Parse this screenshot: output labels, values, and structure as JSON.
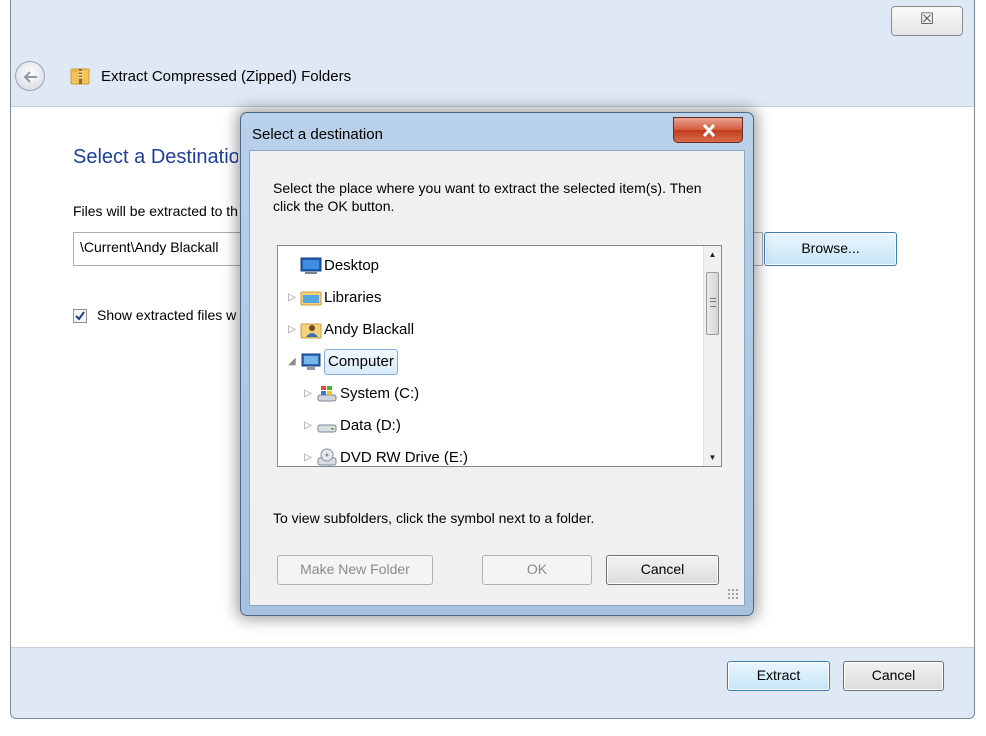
{
  "wizard": {
    "title": "Extract Compressed (Zipped) Folders",
    "close_symbol": "☒",
    "heading": "Select a Destination and Extract Files",
    "files_label": "Files will be extracted to this folder:",
    "path_value": "\\Current\\Andy Blackall",
    "browse_label": "Browse...",
    "show_checked": true,
    "show_label": "Show extracted files when complete",
    "extract_label": "Extract",
    "cancel_label": "Cancel"
  },
  "dialog": {
    "title": "Select a destination",
    "close_symbol": "X",
    "instruction": "Select the place where you want to extract the selected item(s).  Then click the OK button.",
    "tree": [
      {
        "label": "Desktop",
        "icon": "desktop-icon",
        "expander": "",
        "level": 0,
        "selected": false
      },
      {
        "label": "Libraries",
        "icon": "libraries-icon",
        "expander": "▷",
        "level": 0,
        "selected": false
      },
      {
        "label": "Andy Blackall",
        "icon": "user-folder-icon",
        "expander": "▷",
        "level": 0,
        "selected": false
      },
      {
        "label": "Computer",
        "icon": "computer-icon",
        "expander": "◢",
        "level": 0,
        "selected": true
      },
      {
        "label": "System (C:)",
        "icon": "system-drive-icon",
        "expander": "▷",
        "level": 1,
        "selected": false
      },
      {
        "label": "Data (D:)",
        "icon": "hard-drive-icon",
        "expander": "▷",
        "level": 1,
        "selected": false
      },
      {
        "label": "DVD RW Drive (E:)",
        "icon": "dvd-drive-icon",
        "expander": "▷",
        "level": 1,
        "selected": false
      }
    ],
    "hint": "To view subfolders, click the symbol next to a folder.",
    "make_folder_label": "Make New Folder",
    "ok_label": "OK",
    "cancel_label": "Cancel"
  }
}
